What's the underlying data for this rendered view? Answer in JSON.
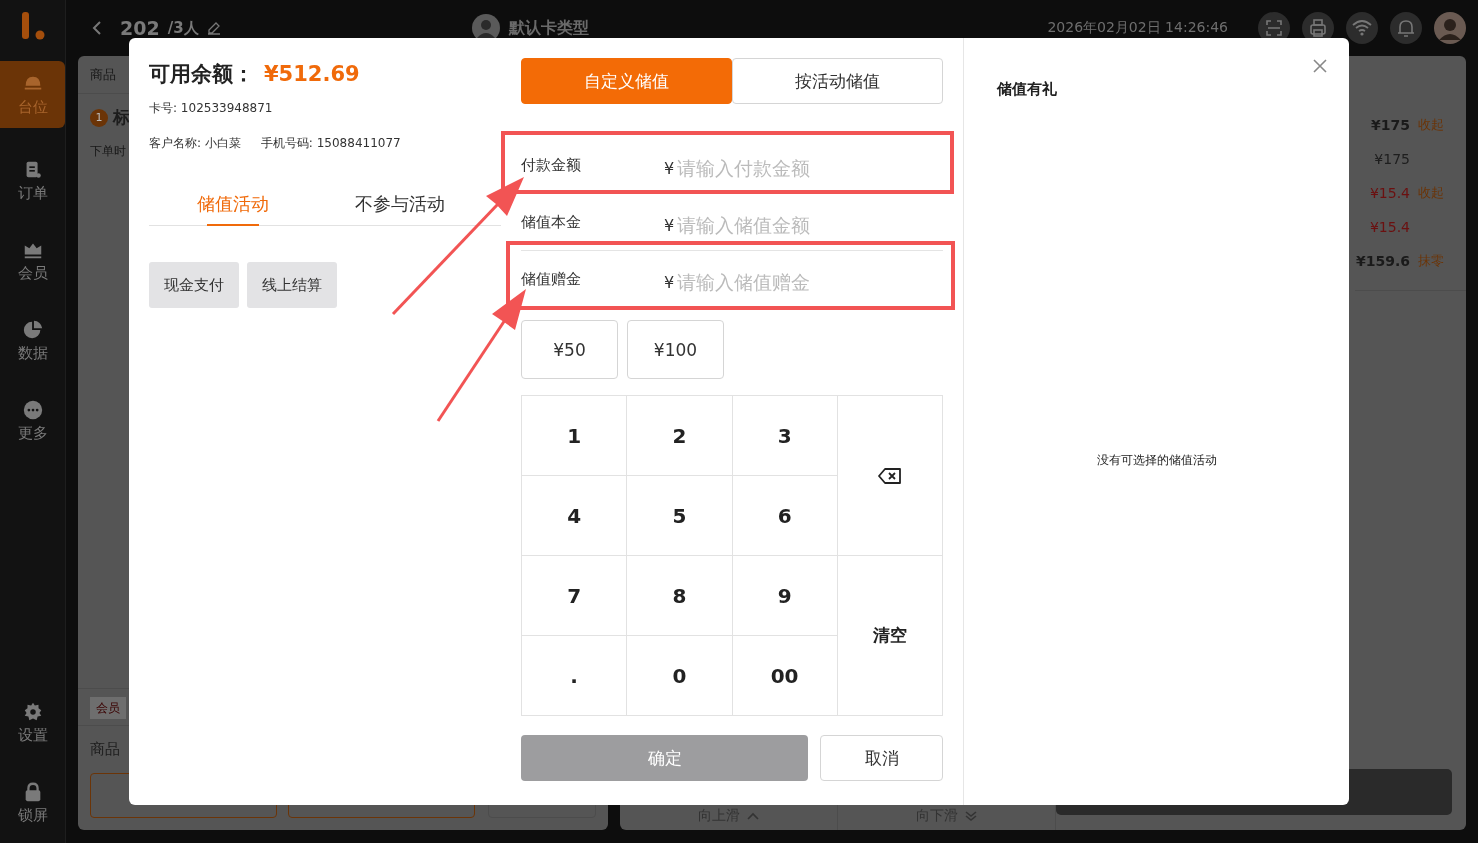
{
  "top_bar": {
    "table_number": "202",
    "guests": "/3人",
    "card_type": "默认卡类型",
    "datetime": "2026年02月02日 14:26:46"
  },
  "sidebar": {
    "items": [
      {
        "label": "台位",
        "selected": true
      },
      {
        "label": "订单",
        "selected": false
      },
      {
        "label": "会员",
        "selected": false
      },
      {
        "label": "数据",
        "selected": false
      },
      {
        "label": "更多",
        "selected": false
      }
    ],
    "bottom_items": [
      {
        "label": "设置"
      },
      {
        "label": "锁屏"
      }
    ]
  },
  "order_panel": {
    "column_header": "商品",
    "item_number": "1",
    "item_name": "标",
    "order_time_label": "下单时",
    "member_tag": "会员",
    "goods_label": "商品"
  },
  "summary_panel": {
    "rows": [
      {
        "kind": "total",
        "amount": "¥175",
        "action": "收起"
      },
      {
        "kind": "original",
        "amount": "¥175"
      },
      {
        "kind": "discount",
        "amount": "¥15.4",
        "action": "收起"
      },
      {
        "kind": "discount",
        "amount": "¥15.4"
      },
      {
        "kind": "total",
        "amount": "¥159.6",
        "action": "抹零"
      }
    ],
    "scroll_up": "向上滑",
    "scroll_down": "向下滑"
  },
  "dialog": {
    "balance_label": "可用余额：",
    "balance": "¥512.69",
    "card_number": "卡号: 102533948871",
    "customer": "客户名称: 小白菜",
    "phone": "手机号码: 15088411077",
    "activity_tabs": [
      {
        "label": "储值活动",
        "selected": true
      },
      {
        "label": "不参与活动",
        "selected": false
      }
    ],
    "payment_buttons": [
      "现金支付",
      "线上结算"
    ],
    "mode_tabs": [
      {
        "label": "自定义储值",
        "selected": true
      },
      {
        "label": "按活动储值",
        "selected": false
      }
    ],
    "fields": [
      {
        "label": "付款金额",
        "prefix": "¥",
        "placeholder": "请输入付款金额"
      },
      {
        "label": "储值本金",
        "prefix": "¥",
        "placeholder": "请输入储值金额"
      },
      {
        "label": "储值赠金",
        "prefix": "¥",
        "placeholder": "请输入储值赠金"
      }
    ],
    "quick_amounts": [
      "¥50",
      "¥100"
    ],
    "keypad": [
      {
        "kind": "digit",
        "label": "1"
      },
      {
        "kind": "digit",
        "label": "2"
      },
      {
        "kind": "digit",
        "label": "3"
      },
      {
        "kind": "backspace"
      },
      {
        "kind": "digit",
        "label": "4"
      },
      {
        "kind": "digit",
        "label": "5"
      },
      {
        "kind": "digit",
        "label": "6"
      },
      {
        "kind": "digit",
        "label": "7"
      },
      {
        "kind": "digit",
        "label": "8"
      },
      {
        "kind": "digit",
        "label": "9"
      },
      {
        "kind": "clear",
        "label": "清空"
      },
      {
        "kind": "digit",
        "label": "."
      },
      {
        "kind": "digit",
        "label": "0"
      },
      {
        "kind": "digit",
        "label": "00"
      }
    ],
    "confirm": {
      "label": "确定",
      "disabled": true
    },
    "cancel": "取消",
    "gift_title": "储值有礼",
    "empty_message": "没有可选择的储值活动"
  }
}
